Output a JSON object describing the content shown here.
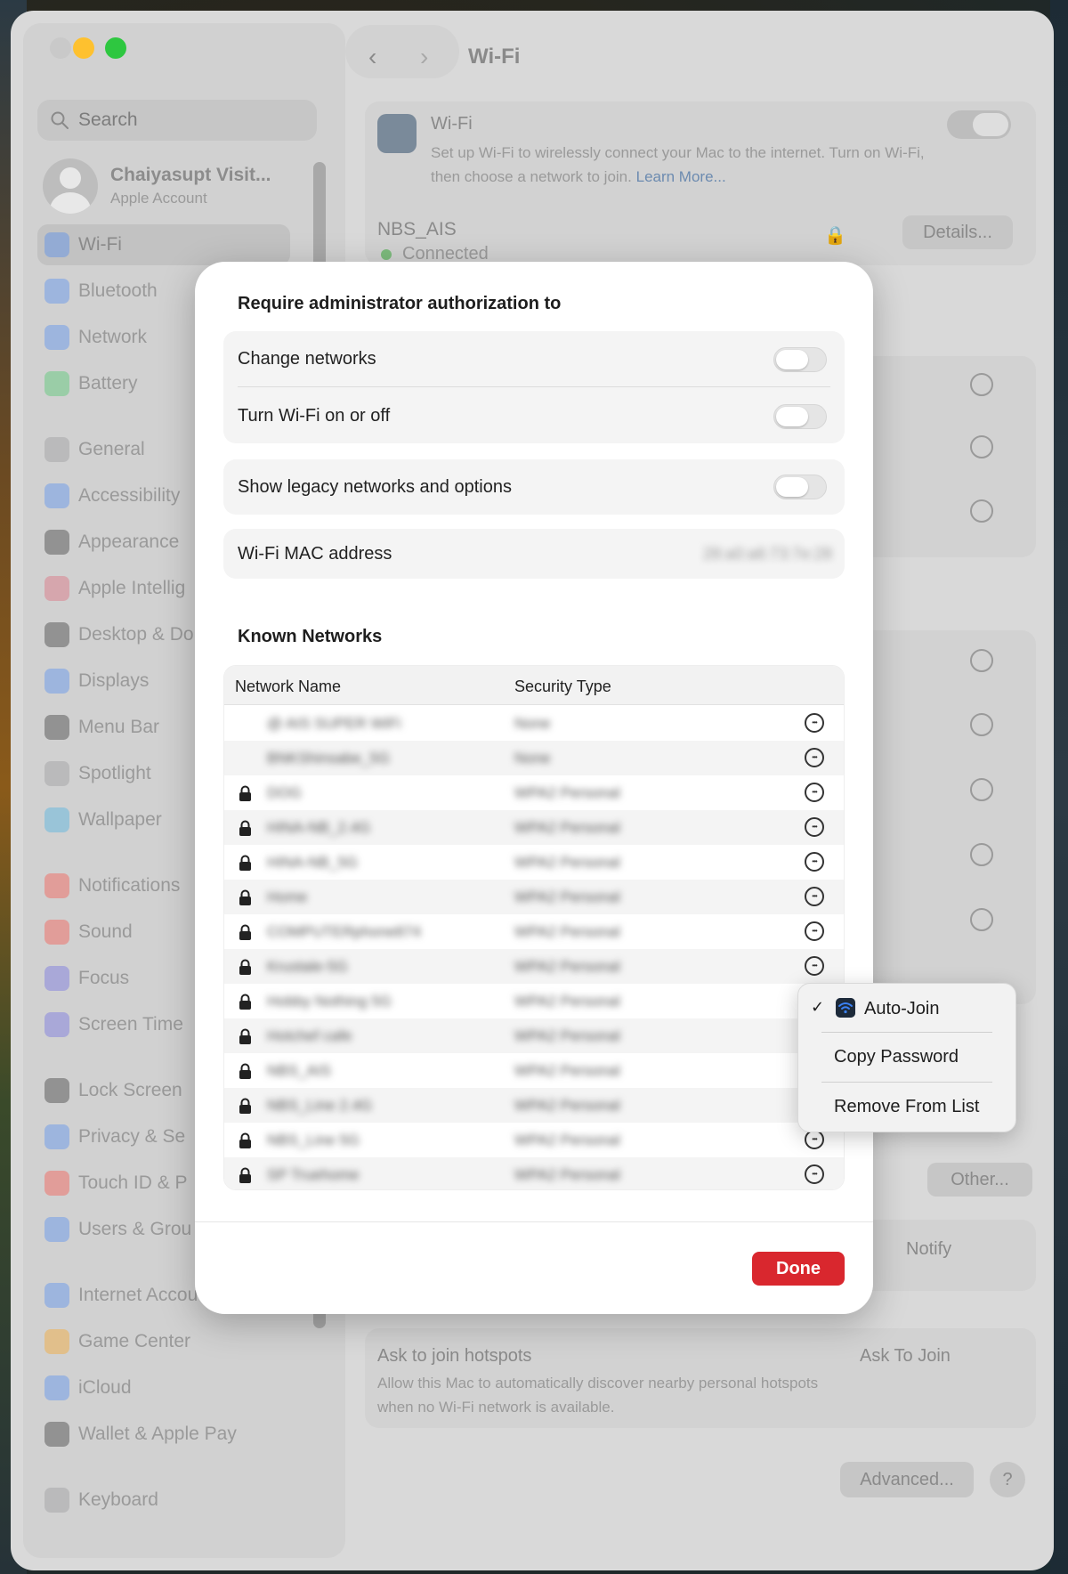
{
  "window": {
    "title": "Wi-Fi"
  },
  "sidebar": {
    "search_placeholder": "Search",
    "account_name": "Chaiyasupt Visit...",
    "account_sub": "Apple Account",
    "items": [
      {
        "label": "Wi-Fi",
        "icon": "wifi-icon",
        "color": "#3b82f6"
      },
      {
        "label": "Bluetooth",
        "icon": "bluetooth-icon",
        "color": "#3b82f6"
      },
      {
        "label": "Network",
        "icon": "globe-icon",
        "color": "#3b82f6"
      },
      {
        "label": "Battery",
        "icon": "battery-icon",
        "color": "#34c759"
      },
      {
        "label": "General",
        "icon": "gear-icon",
        "color": "#8e8e93"
      },
      {
        "label": "Accessibility",
        "icon": "accessibility-icon",
        "color": "#3b82f6"
      },
      {
        "label": "Appearance",
        "icon": "appearance-icon",
        "color": "#1c1c1e"
      },
      {
        "label": "Apple Intellig",
        "icon": "apple-intelligence-icon",
        "color": "#e0566b"
      },
      {
        "label": "Desktop & Do",
        "icon": "desktop-icon",
        "color": "#1c1c1e"
      },
      {
        "label": "Displays",
        "icon": "displays-icon",
        "color": "#3b82f6"
      },
      {
        "label": "Menu Bar",
        "icon": "menu-bar-icon",
        "color": "#1c1c1e"
      },
      {
        "label": "Spotlight",
        "icon": "spotlight-icon",
        "color": "#8e8e93"
      },
      {
        "label": "Wallpaper",
        "icon": "wallpaper-icon",
        "color": "#32ade6"
      },
      {
        "label": "Notifications",
        "icon": "notifications-icon",
        "color": "#ff3b30"
      },
      {
        "label": "Sound",
        "icon": "sound-icon",
        "color": "#ff3b30"
      },
      {
        "label": "Focus",
        "icon": "focus-icon",
        "color": "#5e5ce6"
      },
      {
        "label": "Screen Time",
        "icon": "screen-time-icon",
        "color": "#5e5ce6"
      },
      {
        "label": "Lock Screen",
        "icon": "lock-screen-icon",
        "color": "#1c1c1e"
      },
      {
        "label": "Privacy & Se",
        "icon": "privacy-icon",
        "color": "#3b82f6"
      },
      {
        "label": "Touch ID & P",
        "icon": "touch-id-icon",
        "color": "#ff3b30"
      },
      {
        "label": "Users & Grou",
        "icon": "users-icon",
        "color": "#3b82f6"
      },
      {
        "label": "Internet Accou",
        "icon": "internet-accounts-icon",
        "color": "#3b82f6"
      },
      {
        "label": "Game Center",
        "icon": "game-center-icon",
        "color": "#ff9f0a"
      },
      {
        "label": "iCloud",
        "icon": "icloud-icon",
        "color": "#3b82f6"
      },
      {
        "label": "Wallet & Apple Pay",
        "icon": "wallet-icon",
        "color": "#1c1c1e"
      },
      {
        "label": "Keyboard",
        "icon": "keyboard-icon",
        "color": "#8e8e93"
      }
    ]
  },
  "background": {
    "wifi_title": "Wi-Fi",
    "wifi_desc": "Set up Wi-Fi to wirelessly connect your Mac to the internet. Turn on Wi-Fi, then choose a network to join.",
    "learn_more": "Learn More...",
    "current_network": "NBS_AIS",
    "current_status": "Connected",
    "details_button": "Details...",
    "other_button": "Other...",
    "notify_value": "Notify",
    "hotspots_title": "Ask to join hotspots",
    "hotspots_desc": "Allow this Mac to automatically discover nearby personal hotspots when no Wi-Fi network is available.",
    "hotspots_value": "Ask To Join",
    "advanced_button": "Advanced...",
    "help_button": "?"
  },
  "dialog": {
    "heading": "Require administrator authorization to",
    "change_networks": "Change networks",
    "turn_wifi": "Turn Wi-Fi on or off",
    "legacy": "Show legacy networks and options",
    "mac_label": "Wi-Fi MAC address",
    "mac_value": "28:a0:a6:73:7e:28",
    "known_heading": "Known Networks",
    "col_name": "Network Name",
    "col_security": "Security Type",
    "done": "Done",
    "accent_color": "#d9272e"
  },
  "known_networks": [
    {
      "name": "@ AIS SUPER WiFi",
      "security": "None",
      "locked": false
    },
    {
      "name": "BNKShinsabe_5G",
      "security": "None",
      "locked": false
    },
    {
      "name": "DOG",
      "security": "WPA2 Personal",
      "locked": true
    },
    {
      "name": "HINA-NB_2.4G",
      "security": "WPA2 Personal",
      "locked": true
    },
    {
      "name": "HINA-NB_5G",
      "security": "WPA2 Personal",
      "locked": true
    },
    {
      "name": "Home",
      "security": "WPA2 Personal",
      "locked": true
    },
    {
      "name": "COMPUTERphone874",
      "security": "WPA2 Personal",
      "locked": true
    },
    {
      "name": "Krustale-5G",
      "security": "WPA2 Personal",
      "locked": true
    },
    {
      "name": "Hobby Nothing 5G",
      "security": "WPA2 Personal",
      "locked": true
    },
    {
      "name": "Hotchef cafe",
      "security": "WPA2 Personal",
      "locked": true
    },
    {
      "name": "NBS_AIS",
      "security": "WPA2 Personal",
      "locked": true
    },
    {
      "name": "NBS_Line 2.4G",
      "security": "WPA2 Personal",
      "locked": true
    },
    {
      "name": "NBS_Line 5G",
      "security": "WPA2 Personal",
      "locked": true
    },
    {
      "name": "SP Truehome",
      "security": "WPA2 Personal",
      "locked": true
    }
  ],
  "context_menu": {
    "auto_join": "Auto-Join",
    "auto_join_checked": "✓",
    "copy_password": "Copy Password",
    "remove": "Remove From List"
  }
}
